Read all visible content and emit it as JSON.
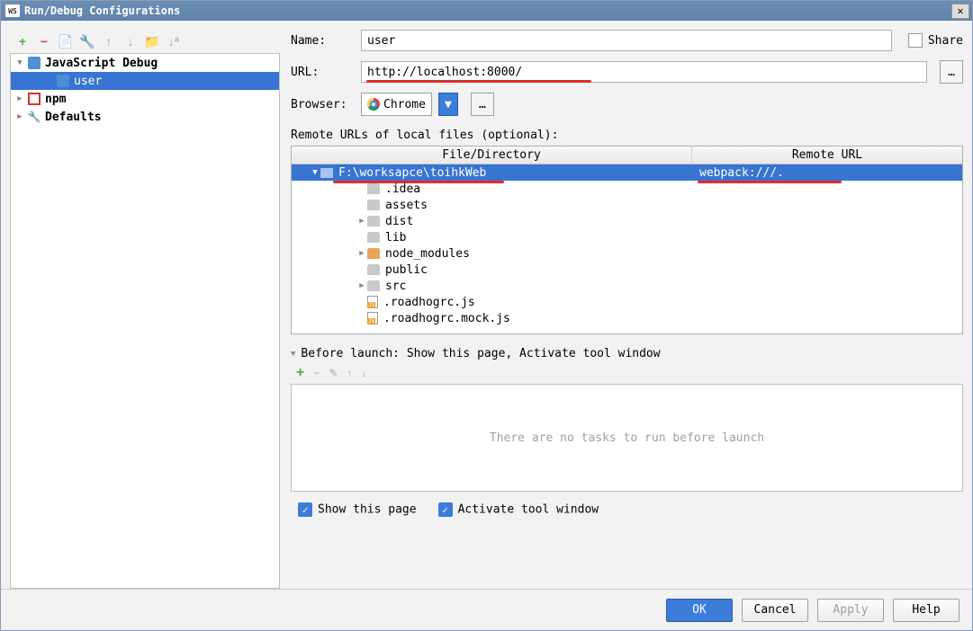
{
  "window": {
    "title": "Run/Debug Configurations"
  },
  "tree": {
    "root1": "JavaScript Debug",
    "root1_child": "user",
    "root2": "npm",
    "root3": "Defaults"
  },
  "form": {
    "name_label": "Name:",
    "name_value": "user",
    "share_label": "Share",
    "url_label": "URL:",
    "url_value": "http://localhost:8000/",
    "browser_label": "Browser:",
    "browser_value": "Chrome",
    "remote_label": "Remote URLs of local files (optional):"
  },
  "file_table": {
    "col1": "File/Directory",
    "col2": "Remote URL",
    "root_path": "F:\\worksapce\\toihkWeb",
    "root_remote": "webpack:///.",
    "rows": [
      {
        "name": ".idea",
        "type": "folder-grey"
      },
      {
        "name": "assets",
        "type": "folder-grey"
      },
      {
        "name": "dist",
        "type": "folder-grey",
        "expandable": true
      },
      {
        "name": "lib",
        "type": "folder-grey"
      },
      {
        "name": "node_modules",
        "type": "folder-orange",
        "expandable": true
      },
      {
        "name": "public",
        "type": "folder-grey"
      },
      {
        "name": "src",
        "type": "folder-grey",
        "expandable": true
      },
      {
        "name": ".roadhogrc.js",
        "type": "file-js"
      },
      {
        "name": ".roadhogrc.mock.js",
        "type": "file-js"
      }
    ]
  },
  "before_launch": {
    "label": "Before launch: Show this page, Activate tool window",
    "empty_text": "There are no tasks to run before launch",
    "check1": "Show this page",
    "check2": "Activate tool window"
  },
  "buttons": {
    "ok": "OK",
    "cancel": "Cancel",
    "apply": "Apply",
    "help": "Help"
  }
}
